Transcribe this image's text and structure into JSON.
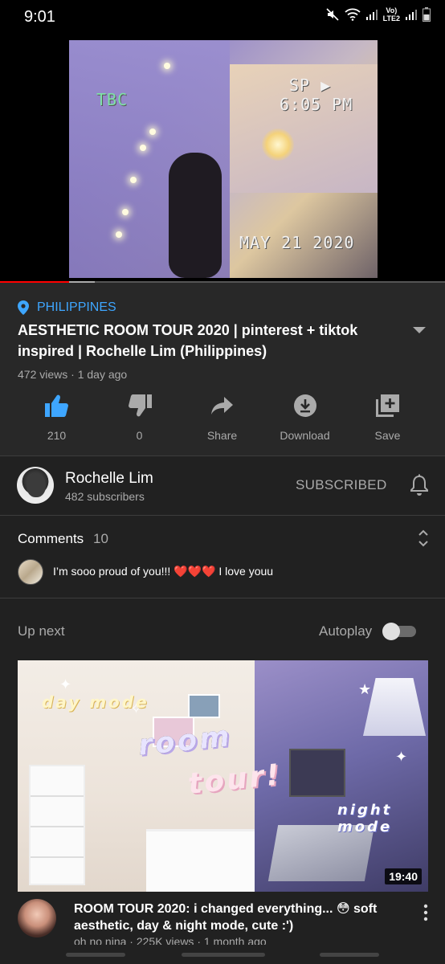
{
  "status_bar": {
    "time": "9:01",
    "lte_line1": "Vo)",
    "lte_line2": "LTE2",
    "icons": [
      "mute-icon",
      "wifi-icon",
      "signal-icon",
      "signal-icon",
      "battery-icon"
    ]
  },
  "player": {
    "overlay_tbc": "TBC",
    "overlay_sp": "SP ▶",
    "overlay_time": "6:05 PM",
    "overlay_date": "MAY 21 2020",
    "progress_played": 0.155,
    "progress_buffered": 0.213,
    "colors": {
      "played": "#ff0000",
      "buffered": "#aaaaaa"
    }
  },
  "video": {
    "location": "PHILIPPINES",
    "title": "AESTHETIC ROOM TOUR 2020 | pinterest + tiktok inspired | Rochelle Lim (Philippines)",
    "meta": "472 views · 1 day ago",
    "actions": [
      {
        "icon": "thumbs-up-icon",
        "label": "210",
        "active": true
      },
      {
        "icon": "thumbs-down-icon",
        "label": "0"
      },
      {
        "icon": "share-icon",
        "label": "Share"
      },
      {
        "icon": "download-icon",
        "label": "Download"
      },
      {
        "icon": "save-playlist-icon",
        "label": "Save"
      }
    ],
    "accent_color": "#3ea6ff"
  },
  "channel": {
    "name": "Rochelle Lim",
    "subscribers": "482 subscribers",
    "subscribe_state": "SUBSCRIBED"
  },
  "comments": {
    "heading": "Comments",
    "count": "10",
    "top_comment": "I’m sooo proud of you!!! ❤️❤️❤️ I love youu"
  },
  "up_next": {
    "label": "Up next",
    "autoplay_label": "Autoplay",
    "autoplay_on": false,
    "next_video": {
      "thumb_text_day": "day mode",
      "thumb_text_room": "room",
      "thumb_text_tour": "tour!",
      "thumb_text_night": "night mode",
      "duration": "19:40",
      "title": "ROOM TOUR 2020: i changed everything... 😳 soft aesthetic, day & night mode, cute :')",
      "meta": "oh no nina · 225K views · 1 month ago"
    }
  }
}
